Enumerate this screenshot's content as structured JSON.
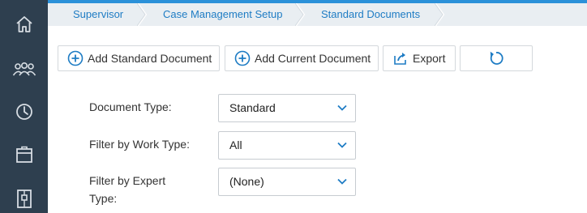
{
  "sidebar": {
    "items": [
      {
        "icon": "home-icon"
      },
      {
        "icon": "users-icon"
      },
      {
        "icon": "dashboard-gauge-icon"
      },
      {
        "icon": "archive-box-icon"
      },
      {
        "icon": "document-panel-icon"
      }
    ]
  },
  "breadcrumb": {
    "items": [
      "Supervisor",
      "Case Management Setup",
      "Standard Documents"
    ]
  },
  "toolbar": {
    "add_standard_label": "Add Standard Document",
    "add_current_label": "Add Current Document",
    "export_label": "Export",
    "refresh_icon": "refresh-icon"
  },
  "form": {
    "document_type": {
      "label": "Document Type:",
      "value": "Standard"
    },
    "work_type": {
      "label": "Filter by Work Type:",
      "value": "All"
    },
    "expert_type": {
      "label_line1": "Filter by Expert",
      "label_line2": "Type:",
      "value": "(None)"
    }
  },
  "colors": {
    "sidebar_bg": "#2e3f4f",
    "accent": "#2b91d9",
    "breadcrumb_bg": "#e9eef2",
    "link": "#1e7cc4"
  }
}
